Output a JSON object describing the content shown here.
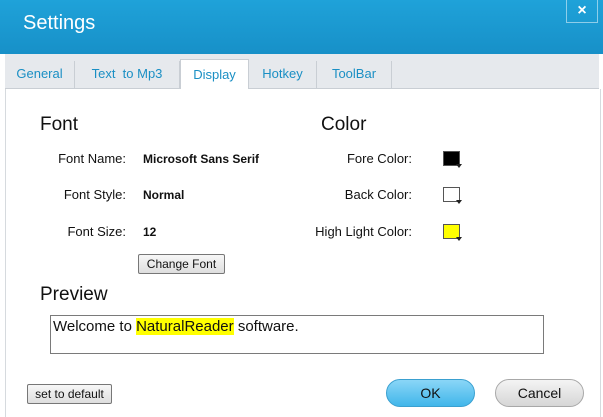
{
  "window": {
    "title": "Settings",
    "close_label": "×"
  },
  "tabs": [
    {
      "label": "General"
    },
    {
      "label": "Text  to Mp3"
    },
    {
      "label": "Display"
    },
    {
      "label": "Hotkey"
    },
    {
      "label": "ToolBar"
    }
  ],
  "active_tab": "Display",
  "font": {
    "heading": "Font",
    "name_label": "Font Name:",
    "name_value": "Microsoft Sans Serif",
    "style_label": "Font Style:",
    "style_value": "Normal",
    "size_label": "Font Size:",
    "size_value": "12",
    "change_button": "Change Font"
  },
  "color": {
    "heading": "Color",
    "fore_label": "Fore Color:",
    "fore_value": "#000000",
    "back_label": "Back Color:",
    "back_value": "#ffffff",
    "highlight_label": "High Light Color:",
    "highlight_value": "#ffff00"
  },
  "preview": {
    "heading": "Preview",
    "text_before": "Welcome to ",
    "text_highlight": "NaturalReader",
    "text_after": " software."
  },
  "buttons": {
    "default": "set to default",
    "ok": "OK",
    "cancel": "Cancel"
  },
  "theme": {
    "accent": "#1a9bd4"
  }
}
